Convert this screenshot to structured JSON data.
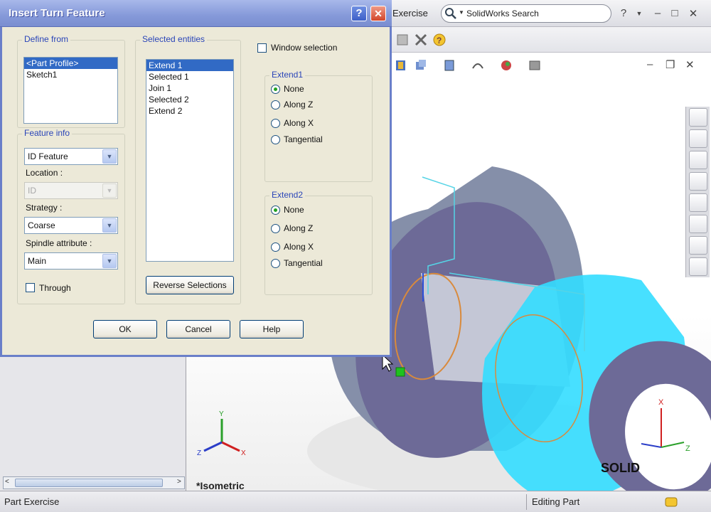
{
  "app": {
    "title": "Exercise",
    "search_placeholder": "SolidWorks Search",
    "help_glyph": "?",
    "minimize_glyph": "–",
    "restore_glyph": "□",
    "close_glyph": "✕",
    "viewport_minimize": "–",
    "viewport_restore": "❐",
    "viewport_close": "✕",
    "view_label": "*Isometric",
    "logo_text": "SOLID",
    "status_left": "Part Exercise",
    "status_right": "Editing Part",
    "scroll_left": "<",
    "scroll_right": ">"
  },
  "dialog": {
    "title": "Insert Turn Feature",
    "help_button": "?",
    "close_button": "✕",
    "define_from": {
      "label": "Define from",
      "items": [
        "<Part Profile>",
        "Sketch1"
      ],
      "selected_index": 0
    },
    "feature_info": {
      "label": "Feature info",
      "type_value": "ID Feature",
      "location_label": "Location :",
      "location_value": "ID",
      "strategy_label": "Strategy :",
      "strategy_value": "Coarse",
      "spindle_label": "Spindle attribute :",
      "spindle_value": "Main",
      "through_label": "Through"
    },
    "selected_entities": {
      "label": "Selected entities",
      "items": [
        "Extend 1",
        "Selected 1",
        "Join 1",
        "Selected 2",
        "Extend 2"
      ],
      "selected_index": 0,
      "reverse_button": "Reverse Selections"
    },
    "window_selection_label": "Window selection",
    "extend1": {
      "label": "Extend1",
      "options": [
        "None",
        "Along Z",
        "Along X",
        "Tangential"
      ],
      "selected": "None"
    },
    "extend2": {
      "label": "Extend2",
      "options": [
        "None",
        "Along Z",
        "Along X",
        "Tangential"
      ],
      "selected": "None"
    },
    "ok_button": "OK",
    "cancel_button": "Cancel",
    "help_button_label": "Help"
  },
  "colors": {
    "dialog_bg": "#ece9d8",
    "group_label": "#2a45b8",
    "selection": "#316ac5",
    "part_face": "#6d6a97",
    "highlight": "#33ddff"
  }
}
